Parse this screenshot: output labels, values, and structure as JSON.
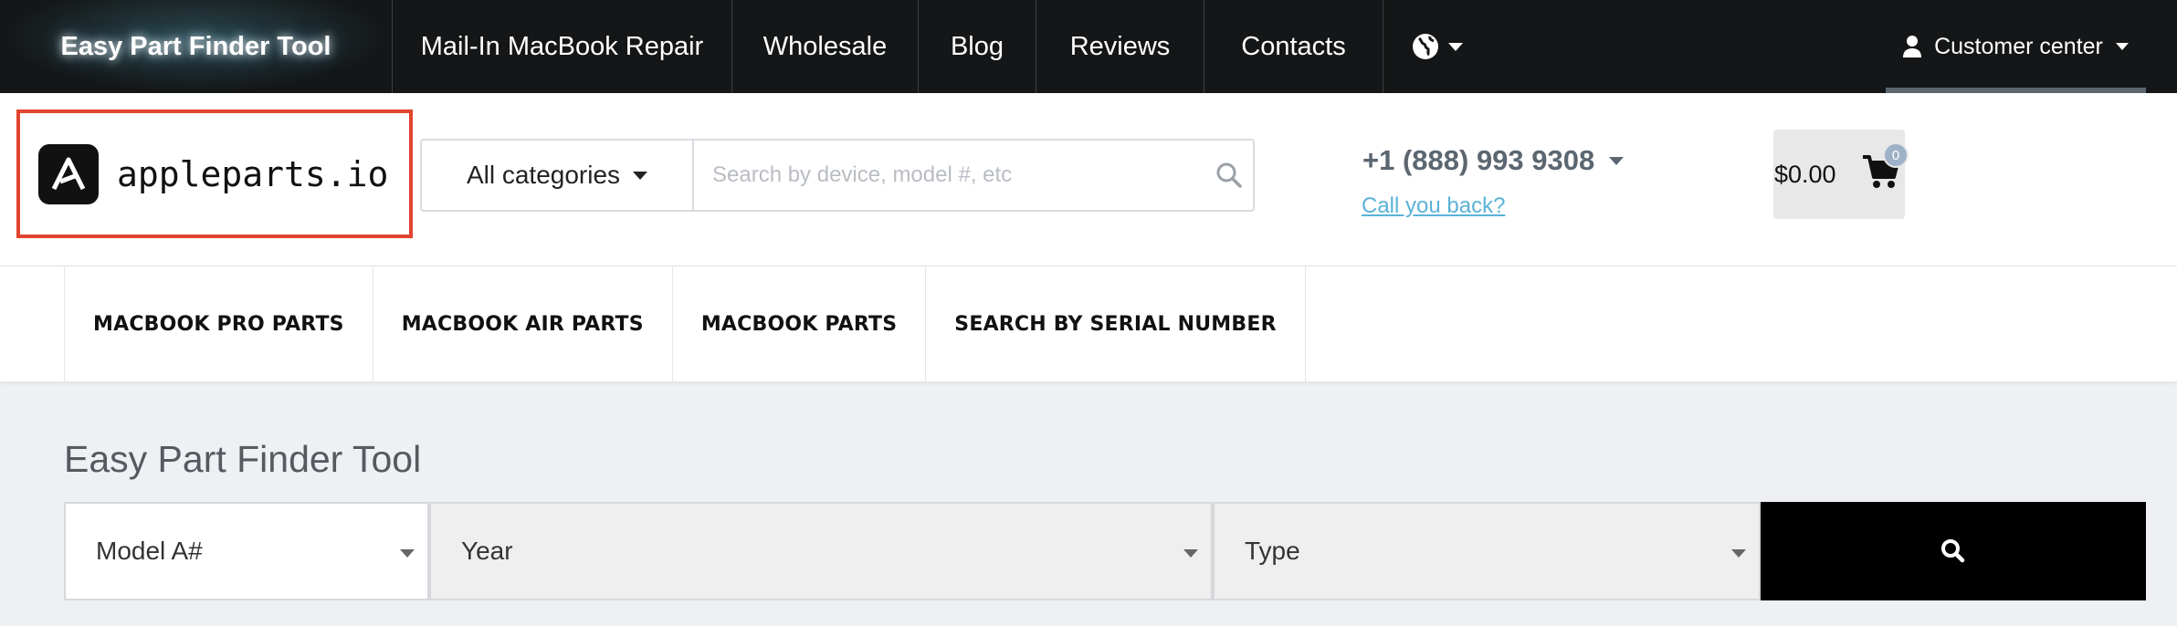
{
  "top_nav": {
    "brand": "Easy Part Finder Tool",
    "items": [
      "Mail-In MacBook Repair",
      "Wholesale",
      "Blog",
      "Reviews",
      "Contacts"
    ],
    "customer_center": "Customer center"
  },
  "header": {
    "logo_text": "appleparts.io",
    "category_button": "All categories",
    "search_placeholder": "Search by device, model #, etc",
    "phone": "+1 (888) 993 9308",
    "callback_link": "Call you back?",
    "cart_amount": "$0.00",
    "cart_count": "0"
  },
  "category_nav": {
    "tabs": [
      "MACBOOK PRO PARTS",
      "MACBOOK AIR PARTS",
      "MACBOOK PARTS",
      "SEARCH BY SERIAL NUMBER"
    ]
  },
  "finder": {
    "title": "Easy Part Finder Tool",
    "model_label": "Model A#",
    "year_label": "Year",
    "type_label": "Type"
  },
  "colors": {
    "top_bar": "#141617",
    "logo_highlight_border": "#e2442f",
    "link": "#5bb2d7",
    "finder_button": "#000000"
  }
}
